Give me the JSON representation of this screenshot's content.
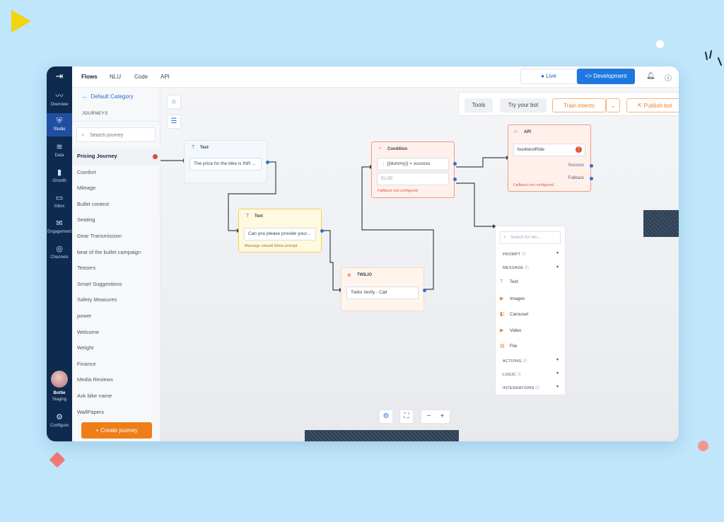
{
  "nav": {
    "items": [
      {
        "label": "Overview",
        "icon": "activity-icon"
      },
      {
        "label": "Studio",
        "icon": "shield-icon"
      },
      {
        "label": "Data",
        "icon": "database-icon"
      },
      {
        "label": "Growth",
        "icon": "bar-chart-icon"
      },
      {
        "label": "Inbox",
        "icon": "inbox-icon"
      },
      {
        "label": "Engagement",
        "icon": "mail-icon"
      },
      {
        "label": "Channels",
        "icon": "broadcast-icon"
      }
    ],
    "bot_name": "Bottie",
    "bot_env": "Staging",
    "configure": "Configure"
  },
  "topbar": {
    "tabs": [
      "Flows",
      "NLU",
      "Code",
      "API"
    ],
    "live": "Live",
    "development": "<> Development"
  },
  "sidebar": {
    "back_label": "Default Category",
    "header": "JOURNEYS",
    "search_placeholder": "Search journey",
    "journeys": [
      "Pricing Journey",
      "Comfort",
      "Mileage",
      "Bullet contest",
      "Seating",
      "Gear Transmission",
      "beat of the bullet campaign",
      "Teasers",
      "Smart Suggestions",
      "Safety Measures",
      "power",
      "Welcome",
      "Weight",
      "Finance",
      "Media Reviews",
      "Ask bike name",
      "WallPapers"
    ],
    "create_button": "+ Create journey"
  },
  "toolbar": {
    "tools": "Tools",
    "try_bot": "Try your bot",
    "train": "Train intents",
    "publish": "Publish bot"
  },
  "nodes": {
    "text1": {
      "title": "Text",
      "content": "The price for the bike is INR ..."
    },
    "text2": {
      "title": "Text",
      "content": "Can you please provide your...",
      "warning": "Message should follow prompt"
    },
    "twilio": {
      "title": "TWILIO",
      "content": "Twilio Verify - Call"
    },
    "condition": {
      "title": "Condition",
      "cond": "{{dummy}} = success",
      "else": "ELSE",
      "warning": "Fallback not configured"
    },
    "api": {
      "title": "API",
      "content": "booktestRide",
      "success": "Success",
      "fallback": "Fallback",
      "warning": "Fallback not configured"
    }
  },
  "palette": {
    "search_placeholder": "Search for res...",
    "sections": {
      "prompt": "PROMPT",
      "message": "MESSAGE",
      "actions": "ACTIONS",
      "logic": "LOGIC",
      "integrations": "INTEGRATIONS"
    },
    "message_items": [
      "Text",
      "Images",
      "Carousel",
      "Video",
      "File"
    ]
  },
  "colors": {
    "rail": "#0f2a4f",
    "accent_blue": "#1f78e0",
    "accent_orange": "#ef7d1a",
    "warn_red": "#e4553a",
    "background": "#bfe6fb"
  }
}
